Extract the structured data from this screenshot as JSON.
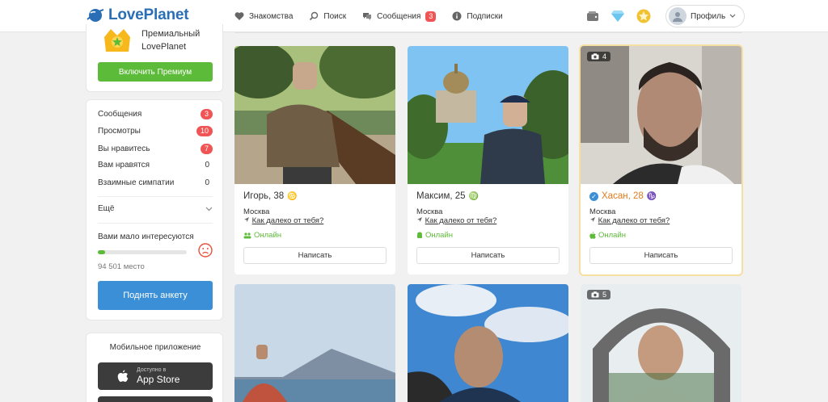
{
  "header": {
    "logo": "LovePlanet",
    "nav": [
      {
        "label": "Знакомства",
        "icon": "heart-icon"
      },
      {
        "label": "Поиск",
        "icon": "search-icon"
      },
      {
        "label": "Сообщения",
        "icon": "chat-icon",
        "badge": "3"
      },
      {
        "label": "Подписки",
        "icon": "info-icon"
      }
    ],
    "right_icons": [
      "wallet-icon",
      "diamond-icon",
      "star-badge-icon"
    ],
    "profile_label": "Профиль"
  },
  "sidebar": {
    "premium": {
      "line1": "Премиальный",
      "line2": "LovePlanet",
      "button": "Включить Премиум"
    },
    "stats": [
      {
        "label": "Сообщения",
        "count": "3",
        "highlight": true
      },
      {
        "label": "Просмотры",
        "count": "10",
        "highlight": true
      },
      {
        "label": "Вы нравитесь",
        "count": "7",
        "highlight": true
      },
      {
        "label": "Вам нравятся",
        "count": "0",
        "highlight": false
      },
      {
        "label": "Взаимные симпатии",
        "count": "0",
        "highlight": false
      }
    ],
    "more": "Ещё",
    "interest": {
      "label": "Вами мало интересуются",
      "place": "94 501 место",
      "progress_percent": 8
    },
    "raise_button": "Поднять анкету",
    "app": {
      "title": "Мобильное приложение",
      "appstore_small": "Доступно в",
      "appstore_big": "App Store"
    }
  },
  "cards": [
    {
      "name": "Игорь, 38",
      "zodiac": "♋",
      "city": "Москва",
      "distance": "Как далеко от тебя?",
      "online": "Онлайн",
      "button": "Написать"
    },
    {
      "name": "Максим, 25",
      "zodiac": "♍",
      "city": "Москва",
      "distance": "Как далеко от тебя?",
      "online": "Онлайн",
      "button": "Написать"
    },
    {
      "name": "Хасан, 28",
      "zodiac": "♑",
      "city": "Москва",
      "distance": "Как далеко от тебя?",
      "online": "Онлайн",
      "button": "Написать",
      "photo_count": "4"
    },
    {
      "photo_count": "5"
    }
  ],
  "colors": {
    "brand": "#2a6fb5",
    "green": "#5dbb3a",
    "red_badge": "#f05454",
    "blue_button": "#3a8fd6",
    "highlight_border": "#f5dfa2"
  }
}
